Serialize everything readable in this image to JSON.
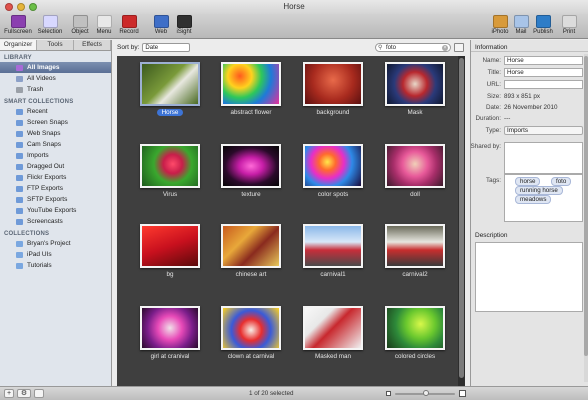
{
  "window": {
    "title": "Horse"
  },
  "toolbar": {
    "left": [
      {
        "label": "Fullscreen",
        "icon": "fullscreen-icon",
        "color": "#8b3fb0"
      },
      {
        "label": "Selection",
        "icon": "selection-icon",
        "color": "#d8d8ff"
      },
      {
        "label": "Object",
        "icon": "object-icon",
        "color": "#c0c0c0"
      },
      {
        "label": "Menu",
        "icon": "menu-icon",
        "color": "#e8e8e8"
      },
      {
        "label": "Record",
        "icon": "record-icon",
        "color": "#cc2a2a"
      },
      {
        "label": "Web",
        "icon": "web-icon",
        "color": "#3f6fc8"
      },
      {
        "label": "iSight",
        "icon": "isight-icon",
        "color": "#303030"
      }
    ],
    "right": [
      {
        "label": "iPhoto",
        "icon": "iphoto-icon",
        "color": "#d89a3a"
      },
      {
        "label": "Mail",
        "icon": "mail-icon",
        "color": "#a8c4e8"
      },
      {
        "label": "Publish",
        "icon": "publish-icon",
        "color": "#2e7dc8"
      },
      {
        "label": "Print",
        "icon": "print-icon",
        "color": "#dcdcdc"
      }
    ]
  },
  "sidebar": {
    "tabs": [
      "Organizer",
      "Tools",
      "Effects"
    ],
    "sections": [
      {
        "title": "LIBRARY",
        "items": [
          {
            "label": "All Images",
            "color": "#a86bd8",
            "selected": true
          },
          {
            "label": "All Videos",
            "color": "#8ba0c8"
          },
          {
            "label": "Trash",
            "color": "#9aa0a8"
          }
        ]
      },
      {
        "title": "SMART COLLECTIONS",
        "items": [
          {
            "label": "Recent",
            "color": "#6f9ad8"
          },
          {
            "label": "Screen Snaps",
            "color": "#6f9ad8"
          },
          {
            "label": "Web Snaps",
            "color": "#6f9ad8"
          },
          {
            "label": "Cam Snaps",
            "color": "#6f9ad8"
          },
          {
            "label": "Imports",
            "color": "#6f9ad8"
          },
          {
            "label": "Dragged Out",
            "color": "#6f9ad8"
          },
          {
            "label": "Flickr Exports",
            "color": "#6f9ad8"
          },
          {
            "label": "FTP Exports",
            "color": "#6f9ad8"
          },
          {
            "label": "SFTP Exports",
            "color": "#6f9ad8"
          },
          {
            "label": "YouTube Exports",
            "color": "#6f9ad8"
          },
          {
            "label": "Screencasts",
            "color": "#6f9ad8"
          }
        ]
      },
      {
        "title": "COLLECTIONS",
        "items": [
          {
            "label": "Bryan's Project",
            "color": "#7aa7e0"
          },
          {
            "label": "iPad UIs",
            "color": "#7aa7e0"
          },
          {
            "label": "Tutorials",
            "color": "#7aa7e0"
          }
        ]
      }
    ]
  },
  "main": {
    "sort_label": "Sort by:",
    "sort_value": "Date",
    "search_value": "foto",
    "items": [
      {
        "caption": "Horse",
        "selected": true,
        "bg": "linear-gradient(135deg,#3c5a1e,#7a9a3a 45%,#e8e8e0 60%,#4a6a22)"
      },
      {
        "caption": "abstract flower",
        "bg": "radial-gradient(circle at 30% 30%,#ff5a1e,#ffd21e 25%,#2ec85a 45%,#1e7ad8 65%,#e82e9a)"
      },
      {
        "caption": "background",
        "bg": "radial-gradient(circle at 50% 40%,#e86a4a,#a82a1e 55%,#5a1010)"
      },
      {
        "caption": "Mask",
        "bg": "radial-gradient(circle at 50% 50%,#e8d8c8,#b8282e 35%,#2a3a7a 60%,#101830)"
      },
      {
        "caption": "Virus",
        "bg": "radial-gradient(circle at 55% 45%,#ff4a6a,#c81e4a 25%,#3aa82e 50%,#1e5a1e)"
      },
      {
        "caption": "texture",
        "bg": "radial-gradient(ellipse at 50% 50%,#ff6ad8,#c81ea8 30%,#2a0a2a 65%,#050505)"
      },
      {
        "caption": "color spots",
        "bg": "radial-gradient(circle at 40% 40%,#ffe84a,#ff6a2e 20%,#e82ec8 40%,#2e8ae8 60%,#1a0a3a)"
      },
      {
        "caption": "doll",
        "bg": "radial-gradient(circle at 50% 45%,#f0d0b8,#e85a9a 35%,#a82e6a 60%,#3a1a2a)"
      },
      {
        "caption": "bg",
        "bg": "linear-gradient(160deg,#ff3a2e,#c8101e 50%,#5a0a0a)"
      },
      {
        "caption": "chinese art",
        "bg": "linear-gradient(135deg,#c85a1e,#e8a83a 35%,#8a2a1e 60%,#e8c85a)"
      },
      {
        "caption": "carnival1",
        "bg": "linear-gradient(180deg,#8ab8e8,#d8e8f8 40%,#c82e3a 60%,#4a4a4a)"
      },
      {
        "caption": "carnival2",
        "bg": "linear-gradient(180deg,#6a6a5a,#e8e8e0 40%,#c82e2e 60%,#3a3a3a)"
      },
      {
        "caption": "girl at cranival",
        "bg": "radial-gradient(circle at 50% 50%,#f0e0e8,#e84ab8 35%,#7a1e8a 65%,#2a0a2a)"
      },
      {
        "caption": "clown at carnival",
        "bg": "radial-gradient(circle at 50% 55%,#f8f0e8,#e82e2e 30%,#3a5ad8 55%,#ffd21e)"
      },
      {
        "caption": "Masked man",
        "bg": "linear-gradient(135deg,#f8f8f8,#e8e8e8 30%,#c8282e 50%,#f0f0f0)"
      },
      {
        "caption": "colored circles",
        "bg": "radial-gradient(circle at 60% 40%,#d8f84a,#6ac82e 35%,#2e8a3a 60%,#1a3a1a)"
      }
    ]
  },
  "info": {
    "header": "Information",
    "name_label": "Name:",
    "name_value": "Horse",
    "title_label": "Title:",
    "title_value": "Horse",
    "url_label": "URL:",
    "url_value": "",
    "size_label": "Size:",
    "size_value": "893 x 851 px",
    "date_label": "Date:",
    "date_value": "26 November 2010",
    "duration_label": "Duration:",
    "duration_value": "---",
    "type_label": "Type:",
    "type_value": "Imports",
    "shared_label": "Shared by:",
    "tags_label": "Tags:",
    "tags": [
      "horse",
      "foto",
      "running horse",
      "meadows"
    ],
    "description_label": "Description"
  },
  "status": {
    "count": "1 of 20 selected"
  }
}
